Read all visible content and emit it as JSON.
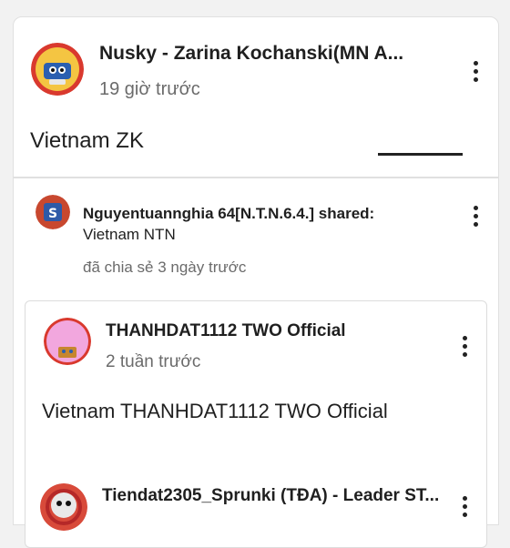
{
  "post": {
    "author": "Nusky - Zarina Kochanski(MN A...",
    "time": "19 giờ trước",
    "text": "Vietnam ZK"
  },
  "share": {
    "header": "Nguyentuannghia 64[N.T.N.6.4.] shared:",
    "caption": "Vietnam NTN",
    "time": "đã chia sẻ 3 ngày trước"
  },
  "shared_post": {
    "author": "THANHDAT1112 TWO Official",
    "time": "2 tuần trước",
    "text": "Vietnam THANHDAT1112 TWO Official",
    "next_author": "Tiendat2305_Sprunki (TĐA) - Leader ST..."
  },
  "icons": {
    "menu": "more-vert-icon"
  },
  "colors": {
    "avatar1_bg": "#e43a3a",
    "avatar2_bg": "#c8482f",
    "avatar3_bg": "#f2a7de",
    "avatar4_bg": "#d84a3a"
  }
}
